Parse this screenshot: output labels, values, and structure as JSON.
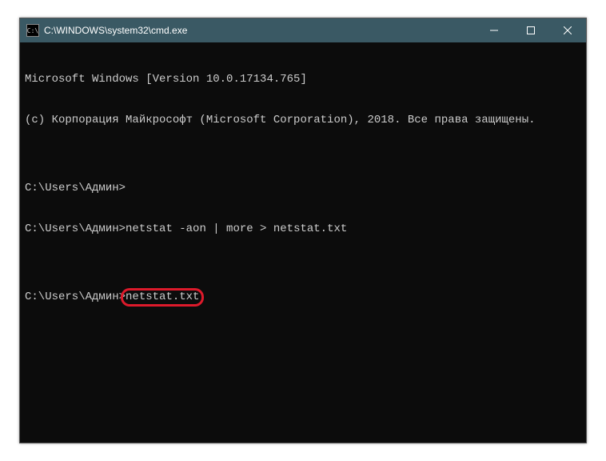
{
  "titlebar": {
    "icon_text": "C:\\",
    "title": "C:\\WINDOWS\\system32\\cmd.exe"
  },
  "terminal": {
    "line1": "Microsoft Windows [Version 10.0.17134.765]",
    "line2": "(c) Корпорация Майкрософт (Microsoft Corporation), 2018. Все права защищены.",
    "blank1": "",
    "prompt1_full": "C:\\Users\\Админ>",
    "prompt2_prefix": "C:\\Users\\Админ>",
    "prompt2_cmd": "netstat -aon | more > netstat.txt",
    "blank2": "",
    "prompt3_prefix": "C:\\Users\\Админ>",
    "prompt3_cmd": "netstat.txt"
  }
}
